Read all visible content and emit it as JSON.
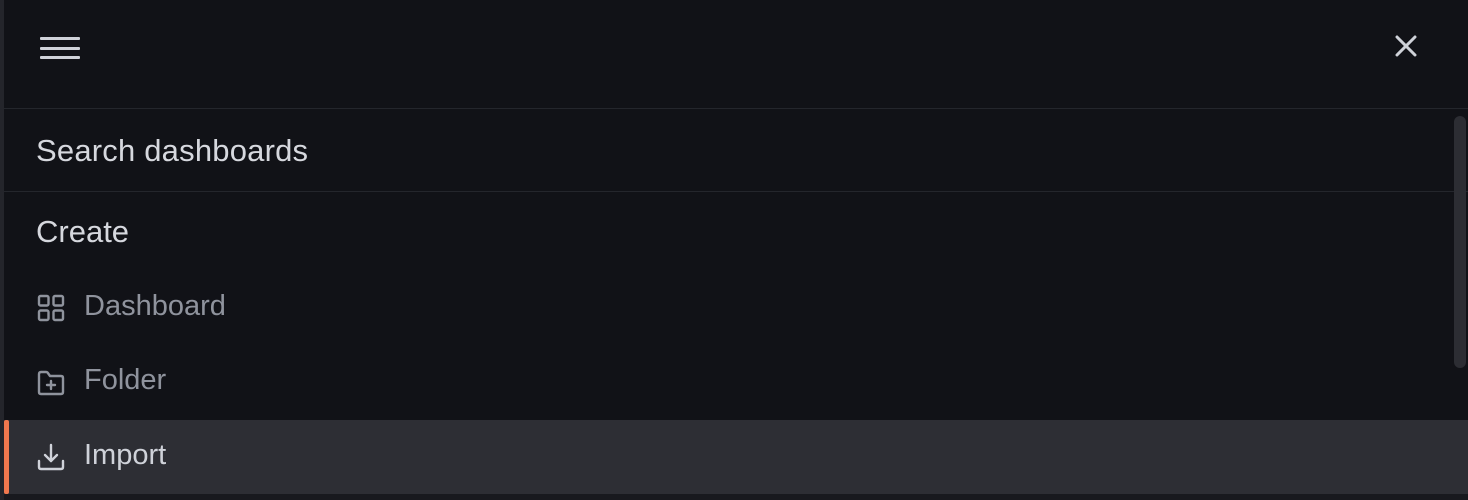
{
  "header": {
    "menu_icon": "hamburger-icon",
    "close_icon": "close-icon"
  },
  "search": {
    "label": "Search dashboards"
  },
  "create": {
    "heading": "Create",
    "items": [
      {
        "label": "Dashboard",
        "icon": "dashboard-grid-icon",
        "active": false
      },
      {
        "label": "Folder",
        "icon": "folder-plus-icon",
        "active": false
      },
      {
        "label": "Import",
        "icon": "import-download-icon",
        "active": true
      }
    ]
  },
  "colors": {
    "background": "#111217",
    "active_background": "#2d2e34",
    "active_accent": "#f0784e",
    "text_primary": "#d6d8de",
    "text_muted": "#8f939d"
  }
}
